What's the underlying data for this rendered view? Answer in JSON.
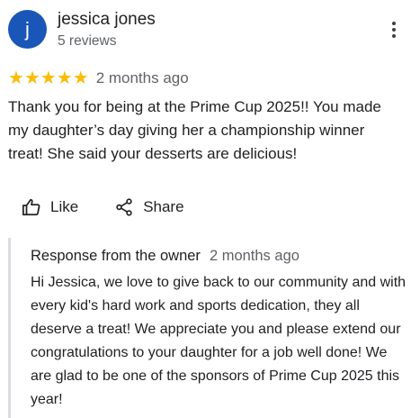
{
  "review": {
    "avatar_initial": "j",
    "reviewer_name": "jessica jones",
    "review_count": "5 reviews",
    "rating": 5,
    "rating_max": 5,
    "date": "2 months ago",
    "text": "Thank you for being at the Prime Cup 2025!! You made my daughter’s day giving her a championship winner treat! She said your desserts are delicious!"
  },
  "actions": {
    "like_label": "Like",
    "share_label": "Share"
  },
  "response": {
    "owner_label": "Response from the owner",
    "date": "2 months ago",
    "text": "Hi Jessica, we love to give back to our community and with every kid's hard work and sports dedication, they all deserve a treat! We appreciate you and please extend our congratulations to your daughter for a job well done! We are glad to be one of the sponsors of Prime Cup 2025 this year!"
  },
  "colors": {
    "avatar_bg": "#1a56b8",
    "star": "#fbbc04",
    "muted_text": "#5f6368",
    "divider": "#dadce0"
  },
  "icons": [
    "more-vert-icon",
    "star-icon",
    "thumb-up-icon",
    "share-icon"
  ]
}
